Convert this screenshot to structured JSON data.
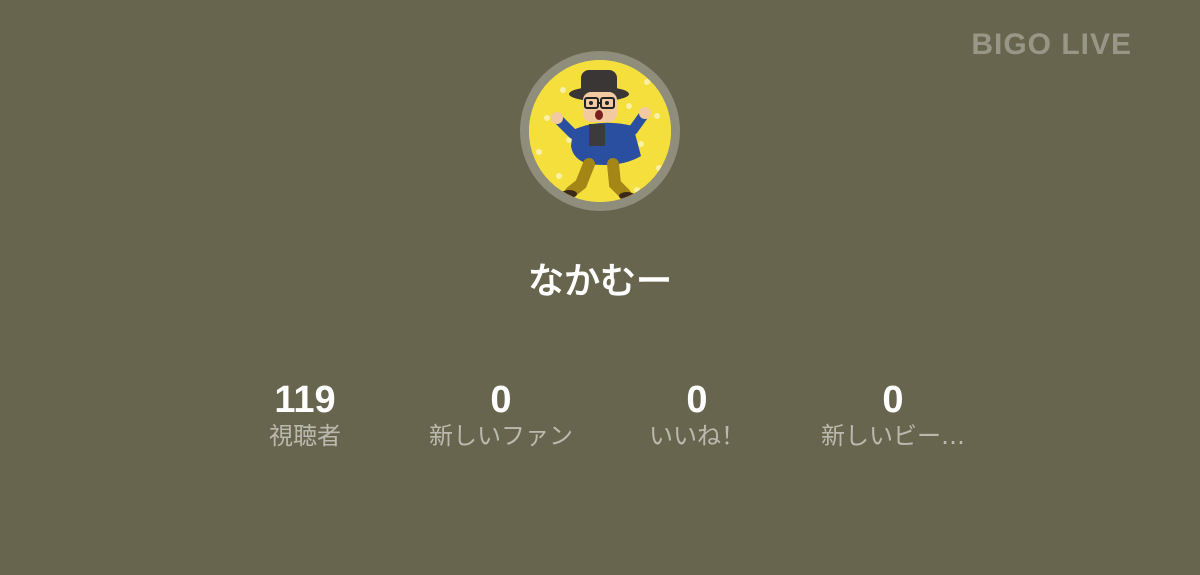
{
  "watermark": "BIGO LIVE",
  "profile": {
    "username": "なかむー"
  },
  "stats": [
    {
      "value": "119",
      "label": "視聴者"
    },
    {
      "value": "0",
      "label": "新しいファン"
    },
    {
      "value": "0",
      "label": "いいね！"
    },
    {
      "value": "0",
      "label": "新しいビー…"
    }
  ],
  "colors": {
    "background": "#67654d",
    "avatar_ring": "#8f8d7c",
    "avatar_bg": "#f4df3c",
    "text_primary": "#ffffff"
  }
}
